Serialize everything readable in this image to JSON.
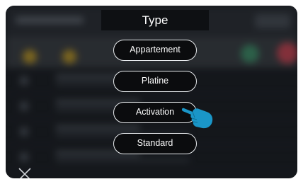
{
  "dialog": {
    "title": "Type",
    "options": [
      {
        "label": "Appartement"
      },
      {
        "label": "Platine"
      },
      {
        "label": "Activation"
      },
      {
        "label": "Standard"
      }
    ]
  },
  "icons": {
    "close": "close-icon",
    "pointer": "pointing-hand-icon"
  },
  "colors": {
    "pointer": "#1a96c8",
    "option_border": "#e9ecef",
    "option_bg": "#0b0c0e",
    "title_bg": "#0e1013"
  }
}
